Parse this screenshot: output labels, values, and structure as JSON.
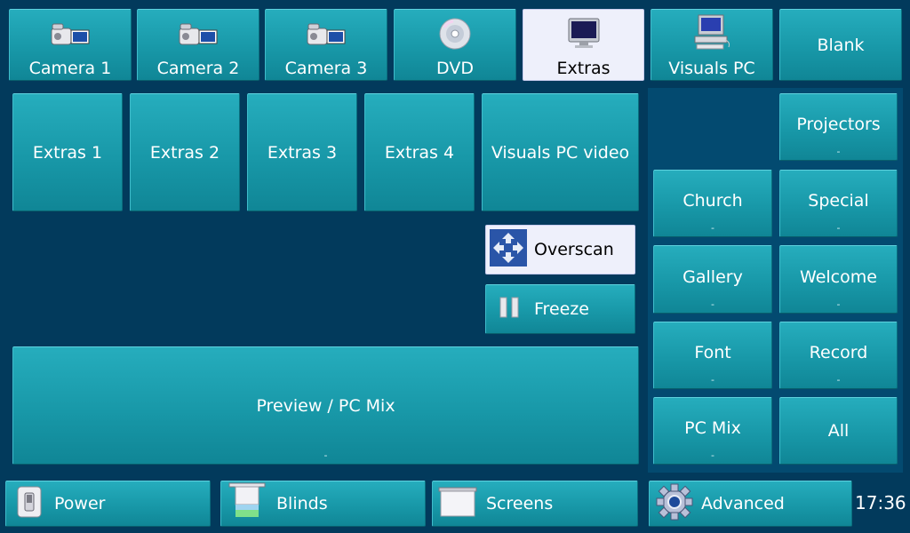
{
  "sources": {
    "camera1": {
      "label": "Camera 1",
      "icon": "camera-icon"
    },
    "camera2": {
      "label": "Camera 2",
      "icon": "camera-icon"
    },
    "camera3": {
      "label": "Camera 3",
      "icon": "camera-icon"
    },
    "dvd": {
      "label": "DVD",
      "icon": "dvd-icon"
    },
    "extras": {
      "label": "Extras",
      "icon": "monitor-icon",
      "selected": true
    },
    "visualspc": {
      "label": "Visuals PC",
      "icon": "computer-icon"
    },
    "blank": {
      "label": "Blank"
    }
  },
  "extras_inputs": {
    "extras1": "Extras 1",
    "extras2": "Extras 2",
    "extras3": "Extras 3",
    "extras4": "Extras 4",
    "visualspc_video": "Visuals PC video"
  },
  "controls": {
    "overscan": {
      "label": "Overscan",
      "icon": "overscan-icon",
      "active": true
    },
    "freeze": {
      "label": "Freeze",
      "icon": "pause-icon"
    }
  },
  "preview": {
    "label": "Preview / PC Mix",
    "status": "-"
  },
  "destinations": {
    "projectors": {
      "label": "Projectors",
      "status": "-"
    },
    "church": {
      "label": "Church",
      "status": "-"
    },
    "special": {
      "label": "Special",
      "status": "-"
    },
    "gallery": {
      "label": "Gallery",
      "status": "-"
    },
    "welcome": {
      "label": "Welcome",
      "status": "-"
    },
    "font": {
      "label": "Font",
      "status": "-"
    },
    "record": {
      "label": "Record",
      "status": "-"
    },
    "pcmix": {
      "label": "PC Mix",
      "status": "-"
    },
    "all": {
      "label": "All"
    }
  },
  "bottom_bar": {
    "power": {
      "label": "Power",
      "icon": "power-switch-icon"
    },
    "blinds": {
      "label": "Blinds",
      "icon": "blinds-icon"
    },
    "screens": {
      "label": "Screens",
      "icon": "screen-icon"
    },
    "advanced": {
      "label": "Advanced",
      "icon": "gear-icon"
    },
    "clock": "17:36"
  },
  "colors": {
    "background": "#023a5c",
    "panel": "#034a70",
    "button": "#1898a8",
    "selected": "#eef0fb"
  }
}
